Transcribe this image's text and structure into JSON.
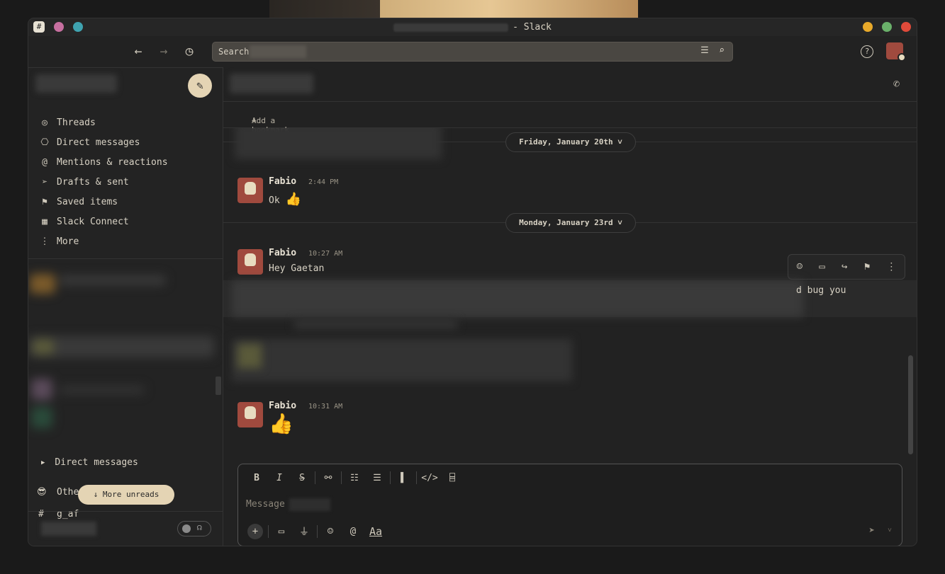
{
  "window": {
    "title_suffix": "- Slack"
  },
  "search": {
    "label": "Search"
  },
  "sidebar": {
    "nav": [
      {
        "icon": "threads-icon",
        "glyph": "◎",
        "label": "Threads"
      },
      {
        "icon": "direct-messages-icon",
        "glyph": "⎔",
        "label": "Direct messages"
      },
      {
        "icon": "mention-icon",
        "glyph": "@",
        "label": "Mentions & reactions"
      },
      {
        "icon": "send-icon",
        "glyph": "➢",
        "label": "Drafts & sent"
      },
      {
        "icon": "bookmark-icon",
        "glyph": "⚑",
        "label": "Saved items"
      },
      {
        "icon": "building-icon",
        "glyph": "▦",
        "label": "Slack Connect"
      },
      {
        "icon": "more-icon",
        "glyph": "⋮",
        "label": "More"
      }
    ],
    "dm_section": "Direct messages",
    "others_section": "Others",
    "others_emoji": "😎",
    "channel_partial": "g_af",
    "more_unreads": "More unreads"
  },
  "channel": {
    "add_bookmark": "Add a bookmark"
  },
  "messages": {
    "date1": "Friday, January 20th",
    "date2": "Monday, January 23rd",
    "m1": {
      "name": "Fabio",
      "time": "2:44 PM",
      "text": "Ok",
      "emoji": "👍"
    },
    "m2": {
      "name": "Fabio",
      "time": "10:27 AM",
      "text": "Hey Gaetan"
    },
    "partial_text": "d bug you",
    "m3": {
      "name": "Fabio",
      "time": "10:31 AM",
      "emoji": "👍"
    }
  },
  "composer": {
    "placeholder": "Message",
    "text_format": "Aa"
  },
  "colors": {
    "accent": "#e4d4b4",
    "bg": "#222222",
    "avatar": "#a04a3e"
  }
}
